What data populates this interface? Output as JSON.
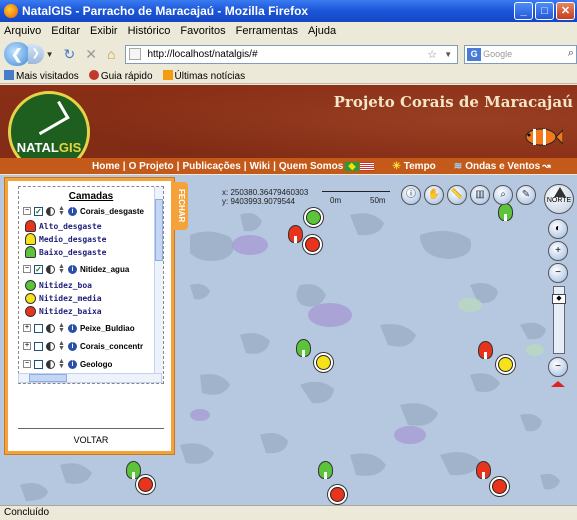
{
  "window": {
    "title": "NatalGIS - Parracho de Maracajaú - Mozilla Firefox"
  },
  "menu": [
    "Arquivo",
    "Editar",
    "Exibir",
    "Histórico",
    "Favoritos",
    "Ferramentas",
    "Ajuda"
  ],
  "nav": {
    "url": "http://localhost/natalgis/#",
    "search_placeholder": "Google"
  },
  "bookmarks": [
    "Mais visitados",
    "Guia rápido",
    "Últimas notícias"
  ],
  "header": {
    "logo_text_1": "NATAL",
    "logo_text_2": "GIS",
    "project_title": "Projeto Corais de Maracajaú"
  },
  "links": {
    "home": "Home",
    "projeto": "O Projeto",
    "publicacoes": "Publicações",
    "wiki": "Wiki",
    "quem_somos": "Quem Somos",
    "tempo": "Tempo",
    "ondas": "Ondas e Ventos",
    "sep": "|"
  },
  "panel": {
    "title": "Camadas",
    "tab_label": "FECHAR",
    "back_label": "VOLTAR",
    "layers": [
      {
        "name": "Corais_desgaste",
        "expanded": true,
        "checked": true
      },
      {
        "name": "Nitidez_agua",
        "expanded": true,
        "checked": true
      },
      {
        "name": "Peixe_Buldiao",
        "expanded": false,
        "checked": false
      },
      {
        "name": "Corais_concentr",
        "expanded": false,
        "checked": false
      },
      {
        "name": "Geologo",
        "expanded": false,
        "checked": false
      }
    ],
    "legend_desgaste": [
      {
        "label": "Alto_desgaste",
        "color": "#e8341c"
      },
      {
        "label": "Medio_desgaste",
        "color": "#f6e21a"
      },
      {
        "label": "Baixo_desgaste",
        "color": "#5cc43a"
      }
    ],
    "legend_nitidez": [
      {
        "label": "Nitidez_boa",
        "color": "#5cc43a"
      },
      {
        "label": "Nitidez_media",
        "color": "#f6e21a"
      },
      {
        "label": "Nitidez_baixa",
        "color": "#e8341c"
      }
    ]
  },
  "map": {
    "coord_x": "x: 250380.36479460303",
    "coord_y": "y: 9403993.9079544",
    "scale_start": "0m",
    "scale_end": "50m",
    "north_label": "NORTE"
  },
  "status": "Concluído",
  "colors": {
    "accent": "#f5a23a",
    "header": "#8a2f16",
    "navlinks": "#c45a1a",
    "water": "#b6c7e0"
  }
}
